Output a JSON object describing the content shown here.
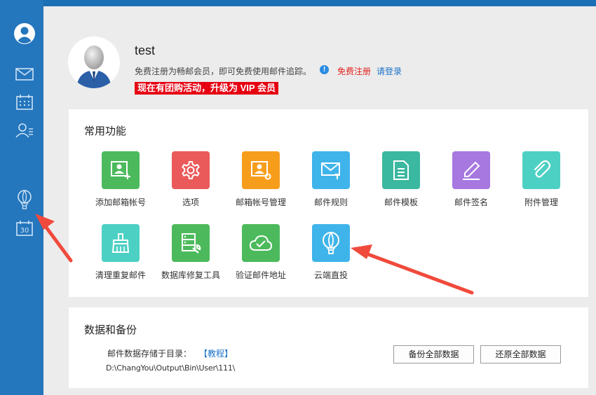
{
  "user": {
    "name": "test",
    "notice": "免费注册为畅邮会员，即可免费使用邮件追踪。",
    "info_icon": "!",
    "free_register": "免费注册",
    "login": "请登录",
    "promo": "现在有团购活动，升级为 VIP 会员"
  },
  "sidebar": {
    "icons": [
      "avatar-icon",
      "mail-icon",
      "calendar-grid-icon",
      "contacts-icon",
      "balloon-icon",
      "calendar-30-icon"
    ],
    "calendar_day": "30"
  },
  "functions": {
    "title": "常用功能",
    "tiles": [
      {
        "label": "添加邮箱帐号",
        "icon": "add-account-icon",
        "color": "#4cba5c"
      },
      {
        "label": "选项",
        "icon": "gear-icon",
        "color": "#ea5a5a"
      },
      {
        "label": "邮箱帐号管理",
        "icon": "account-manage-icon",
        "color": "#f79d1c"
      },
      {
        "label": "邮件规则",
        "icon": "mail-rule-icon",
        "color": "#3fb4ea"
      },
      {
        "label": "邮件模板",
        "icon": "template-icon",
        "color": "#3bb8a0"
      },
      {
        "label": "邮件签名",
        "icon": "signature-icon",
        "color": "#a678e0"
      },
      {
        "label": "附件管理",
        "icon": "paperclip-icon",
        "color": "#4dd0c4"
      },
      {
        "label": "清理重复邮件",
        "icon": "broom-icon",
        "color": "#4dd0c4"
      },
      {
        "label": "数据库修复工具",
        "icon": "database-repair-icon",
        "color": "#4cba5c"
      },
      {
        "label": "验证邮件地址",
        "icon": "cloud-check-icon",
        "color": "#4cba5c"
      },
      {
        "label": "云端直投",
        "icon": "balloon-icon",
        "color": "#3fb4ea"
      }
    ]
  },
  "data": {
    "title": "数据和备份",
    "path_label": "邮件数据存储于目录：",
    "tutorial": "【教程】",
    "path_value": "D:\\ChangYou\\Output\\Bin\\User\\111\\",
    "backup_button": "备份全部数据",
    "restore_button": "还原全部数据"
  },
  "colors": {
    "sidebar": "#2476bd",
    "accent_red": "#e60012",
    "link_blue": "#1c72c8",
    "annotation_arrow": "#f04a3c"
  }
}
